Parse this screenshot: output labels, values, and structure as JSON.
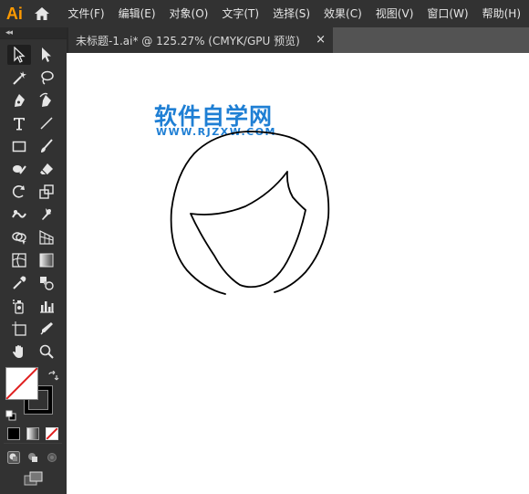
{
  "app": {
    "logo_text": "Ai"
  },
  "menu": {
    "items": [
      "文件(F)",
      "编辑(E)",
      "对象(O)",
      "文字(T)",
      "选择(S)",
      "效果(C)",
      "视图(V)",
      "窗口(W)",
      "帮助(H)"
    ]
  },
  "toolpanel": {
    "collapse_label": "◂◂"
  },
  "tab": {
    "title": "未标题-1.ai* @ 125.27% (CMYK/GPU 预览)",
    "close_label": "×"
  },
  "watermark": {
    "title": "软件自学网",
    "url": "WWW.RJZXW.COM",
    "color": "#1f7fd4"
  },
  "colors": {
    "menubar_bg": "#323232",
    "canvas_bg": "#ffffff",
    "accent_orange": "#ff9a00",
    "none_slash": "#e01e1e"
  },
  "fill_stroke": {
    "fill": "none",
    "stroke": "black"
  }
}
